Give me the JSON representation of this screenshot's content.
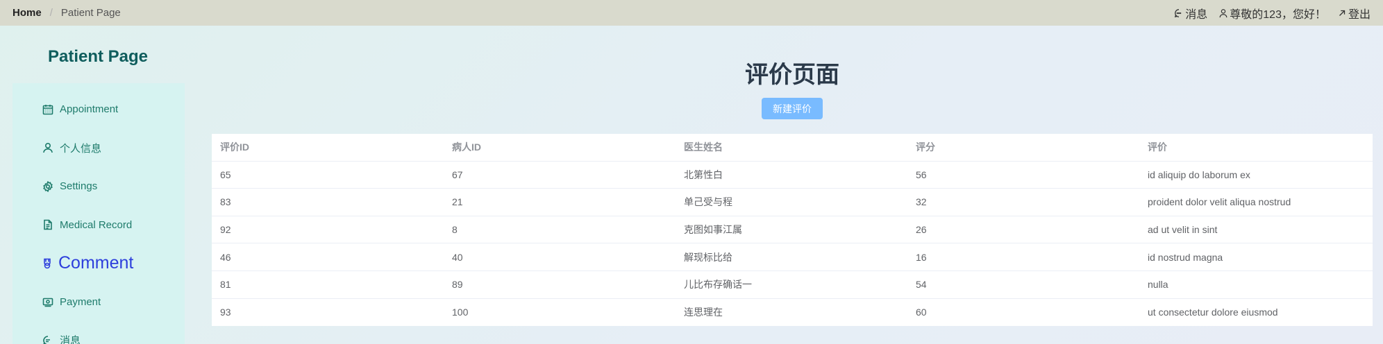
{
  "breadcrumb": {
    "home": "Home",
    "separator": "/",
    "current": "Patient Page"
  },
  "topbar": {
    "messages": "消息",
    "greeting": "尊敬的123，您好！",
    "logout": "登出"
  },
  "sidebar": {
    "title": "Patient Page",
    "items": [
      {
        "label": "Appointment",
        "icon": "calendar-icon"
      },
      {
        "label": "个人信息",
        "icon": "user-icon"
      },
      {
        "label": "Settings",
        "icon": "gear-icon"
      },
      {
        "label": "Medical Record",
        "icon": "document-icon"
      },
      {
        "label": "Comment",
        "icon": "medal-icon",
        "active": true
      },
      {
        "label": "Payment",
        "icon": "money-icon"
      },
      {
        "label": "消息",
        "icon": "chat-icon"
      }
    ]
  },
  "main": {
    "title": "评价页面",
    "new_button": "新建评价",
    "table": {
      "headers": [
        "评价ID",
        "病人ID",
        "医生姓名",
        "评分",
        "评价"
      ],
      "rows": [
        [
          "65",
          "67",
          "北第性白",
          "56",
          "id aliquip do laborum ex"
        ],
        [
          "83",
          "21",
          "单己受与程",
          "32",
          "proident dolor velit aliqua nostrud"
        ],
        [
          "92",
          "8",
          "克图如事江属",
          "26",
          "ad ut velit in sint"
        ],
        [
          "46",
          "40",
          "解现标比给",
          "16",
          "id nostrud magna"
        ],
        [
          "81",
          "89",
          "儿比布存确话一",
          "54",
          "nulla"
        ],
        [
          "93",
          "100",
          "连思理在",
          "60",
          "ut consectetur dolore eiusmod"
        ]
      ]
    }
  },
  "colors": {
    "topbar_bg": "#d9dacd",
    "sidebar_bg": "#d6f3f1",
    "sidebar_text": "#1e7b6b",
    "active_text": "#2d3fdc",
    "button_bg": "#79bbff"
  }
}
